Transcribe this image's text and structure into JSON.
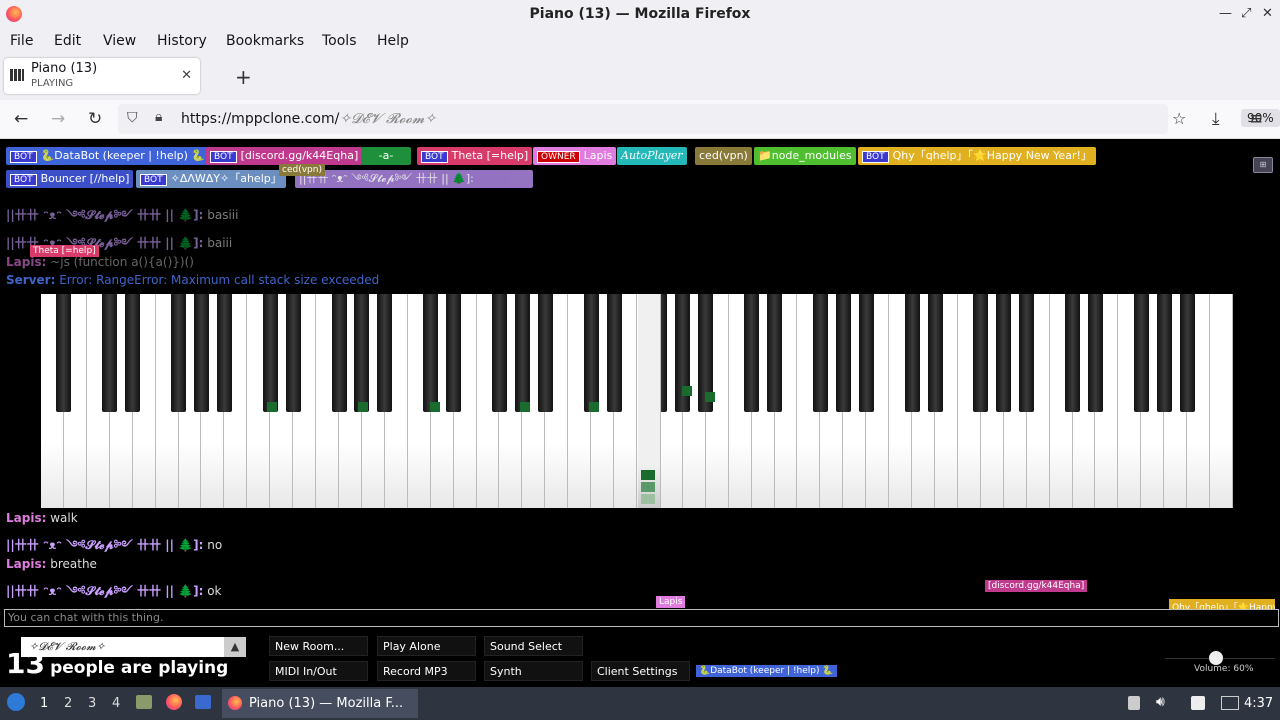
{
  "window": {
    "title": "Piano (13) — Mozilla Firefox"
  },
  "menu": [
    "File",
    "Edit",
    "View",
    "History",
    "Bookmarks",
    "Tools",
    "Help"
  ],
  "tab": {
    "title": "Piano (13)",
    "status": "PLAYING"
  },
  "url": {
    "host": "https://mppclone.com/",
    "path": "✧𝓓𝓔𝓥 𝓡𝓸𝓸𝓶✧"
  },
  "zoom": "90%",
  "users": [
    {
      "bot": "BOT",
      "label": "🐍DataBot (keeper | !help) 🐍",
      "color": "#3f63d8"
    },
    {
      "bot": "BOT",
      "label": "[discord.gg/k44Eqha]",
      "color": "#bf3a8c"
    },
    {
      "label": "-a-",
      "color": "#1e8f3a"
    },
    {
      "bot": "BOT",
      "label": "Theta [=help]",
      "color": "#d83a6a"
    },
    {
      "owner": "OWNER",
      "label": "Lapis",
      "color": "#e07be0"
    },
    {
      "label": "AutoPlayer",
      "color": "#25b8b8"
    },
    {
      "label": "ced(vpn)",
      "color": "#8a7a3a"
    },
    {
      "label": "📁node_modules",
      "color": "#4fbf2f"
    },
    {
      "bot": "BOT",
      "label": "Qhy「qhelp」「🌟Happy New Year!」",
      "color": "#e0b020"
    }
  ],
  "users2": [
    {
      "bot": "BOT",
      "label": "Bouncer [//help]",
      "color": "#3b50c8"
    },
    {
      "bot": "BOT",
      "label": "✧ΔΛWΔY✧「ahelp」",
      "color": "#6b8fc0"
    }
  ],
  "chat": [
    {
      "name": "||卄卄 ᵔᴥᵔ ༺𝓢𝓽𝓮𝓹༻ 卄卄 || 🌲]:",
      "text": "basiii",
      "nameColor": "#c9a0ff"
    },
    {
      "name": "||卄卄 ᵔᴥᵔ ༺𝓢𝓽𝓮𝓹༻ 卄卄 || 🌲]:",
      "text": "baiii",
      "nameColor": "#c9a0ff"
    },
    {
      "name": "Lapis:",
      "text": "~js (function a(){a()})()",
      "nameColor": "#e07be0"
    },
    {
      "name": "Server:",
      "text": "Error: RangeError: Maximum call stack size exceeded",
      "nameColor": "#4f7fff"
    },
    {
      "name": "Lapis:",
      "text": "walk",
      "nameColor": "#e07be0"
    },
    {
      "name": "||卄卄 ᵔᴥᵔ ༺𝓢𝓽𝓮𝓹༻ 卄卄 || 🌲]:",
      "text": "no",
      "nameColor": "#c9a0ff"
    },
    {
      "name": "Lapis:",
      "text": "breathe",
      "nameColor": "#e07be0"
    },
    {
      "name": "||卄卄 ᵔᴥᵔ ༺𝓢𝓽𝓮𝓹༻ 卄卄 || 🌲]:",
      "text": "ok",
      "nameColor": "#c9a0ff"
    }
  ],
  "chat_placeholder": "You can chat with this thing.",
  "room_select": "✧𝓓𝓔𝓥 𝓡𝓸𝓸𝓶✧",
  "playing": {
    "count": "13",
    "text": "people are playing"
  },
  "buttons": {
    "new_room": "New Room...",
    "play_alone": "Play Alone",
    "sound_select": "Sound Select",
    "midi": "MIDI In/Out",
    "record": "Record MP3",
    "synth": "Synth",
    "client_settings": "Client Settings"
  },
  "cursor_tags": {
    "theta": "Theta [=help]",
    "lapis": "Lapis",
    "discord": "[discord.gg/k44Eqha]",
    "qhy": "Qhy「qhelp」「🌟Happy",
    "databot": "🐍DataBot (keeper | !help) 🐍",
    "ced": "ced(vpn)"
  },
  "volume": "Volume: 60%",
  "taskbar": {
    "workspaces": [
      "1",
      "2",
      "3",
      "4"
    ],
    "task_title": "Piano (13) — Mozilla F...",
    "clock": "4:37"
  }
}
